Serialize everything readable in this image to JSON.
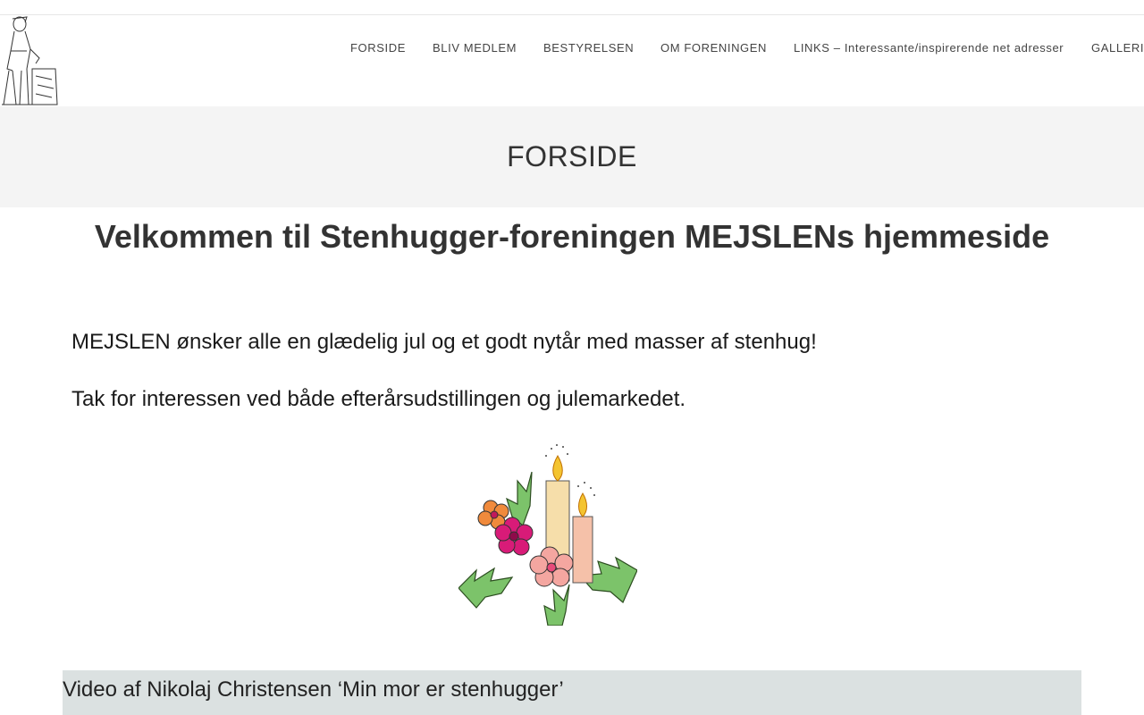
{
  "header": {
    "logo": "stonemason-logo",
    "nav": [
      {
        "label": "FORSIDE",
        "name": "nav-forside"
      },
      {
        "label": "BLIV MEDLEM",
        "name": "nav-bliv-medlem"
      },
      {
        "label": "BESTYRELSEN",
        "name": "nav-bestyrelsen"
      },
      {
        "label": "OM FORENINGEN",
        "name": "nav-om-foreningen"
      },
      {
        "label": "LINKS – Interessante/inspirerende net adresser",
        "name": "nav-links"
      },
      {
        "label": "GALLERI",
        "name": "nav-galleri"
      }
    ]
  },
  "banner": {
    "title": "FORSIDE"
  },
  "content": {
    "welcome": "Velkommen til Stenhugger-foreningen MEJSLENs hjemmeside",
    "paragraph1": "MEJSLEN ønsker alle en glædelig jul og et godt nytår med masser af stenhug!",
    "paragraph2": "Tak for interessen ved både efterårsudstillingen og julemarkedet.",
    "image": "christmas-candles-illustration",
    "video_title": "Video af Nikolaj Christensen ‘Min mor er stenhugger’"
  },
  "colors": {
    "banner_bg": "#f4f4f4",
    "video_bar_bg": "#dbe1e1",
    "text": "#333333"
  }
}
